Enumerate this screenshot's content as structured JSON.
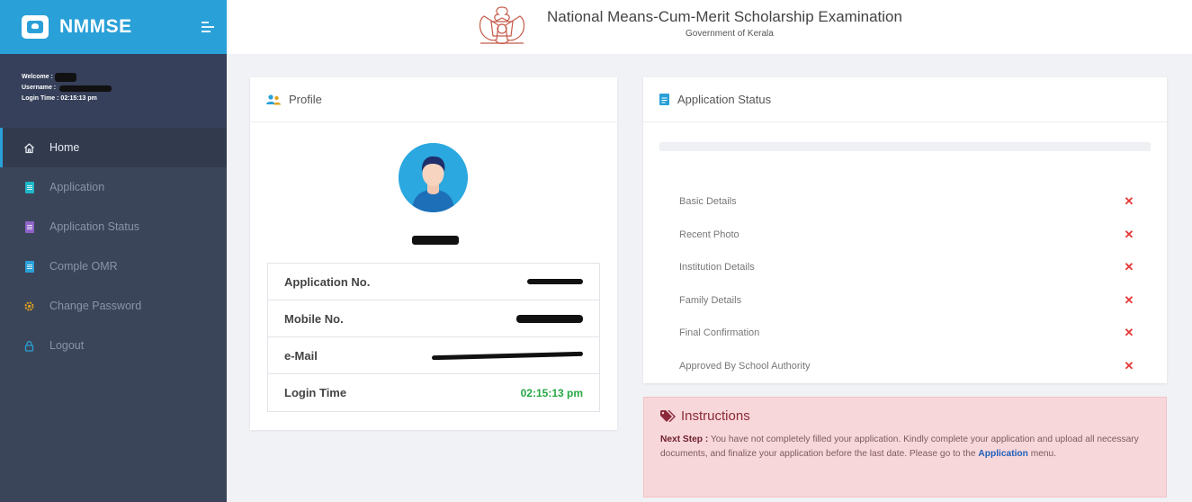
{
  "brand": {
    "name": "NMMSE"
  },
  "user": {
    "welcome_label": "Welcome :",
    "username_label": "Username :",
    "login_time_label": "Login Time : 02:15:13 pm"
  },
  "nav": {
    "items": [
      {
        "label": "Home",
        "icon": "home-icon"
      },
      {
        "label": "Application",
        "icon": "document-icon"
      },
      {
        "label": "Application Status",
        "icon": "document-icon"
      },
      {
        "label": "Comple OMR",
        "icon": "document-icon"
      },
      {
        "label": "Change Password",
        "icon": "gear-icon"
      },
      {
        "label": "Logout",
        "icon": "lock-icon"
      }
    ]
  },
  "header": {
    "title": "National Means-Cum-Merit Scholarship Examination",
    "subtitle": "Government of Kerala"
  },
  "profile": {
    "heading": "Profile",
    "rows": [
      {
        "label": "Application No."
      },
      {
        "label": "Mobile No."
      },
      {
        "label": "e-Mail"
      },
      {
        "label": "Login Time",
        "value": "02:15:13 pm"
      }
    ]
  },
  "status": {
    "heading": "Application Status",
    "progress_percent": 0,
    "items": [
      {
        "label": "Basic Details"
      },
      {
        "label": "Recent Photo"
      },
      {
        "label": "Institution Details"
      },
      {
        "label": "Family Details"
      },
      {
        "label": "Final Confirmation"
      },
      {
        "label": "Approved By School Authority"
      }
    ],
    "mark": "✕"
  },
  "instructions": {
    "heading": "Instructions",
    "lead": "Next Step :",
    "text": " You have not completely filled your application. Kindly complete your application and upload all necessary documents, and finalize your application before the last date. Please go to the ",
    "link": "Application",
    "tail": " menu."
  },
  "colors": {
    "accent": "#2aa0d8",
    "sidebar": "#3b4559",
    "error": "#e53935",
    "success": "#28a745"
  }
}
